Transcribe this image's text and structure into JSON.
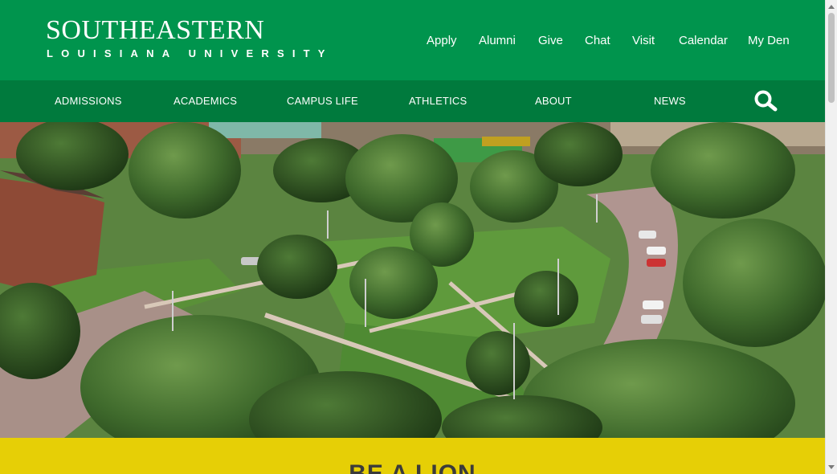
{
  "header": {
    "logo_main": "SOUTHEASTERN",
    "logo_sub": "LOUISIANA UNIVERSITY",
    "utility_links": [
      {
        "label": "Apply"
      },
      {
        "label": "Alumni"
      },
      {
        "label": "Give"
      },
      {
        "label": "Chat"
      },
      {
        "label": "Visit"
      },
      {
        "label": "Calendar"
      },
      {
        "label": "My Den"
      }
    ]
  },
  "main_nav": {
    "items": [
      {
        "label": "ADMISSIONS"
      },
      {
        "label": "ACADEMICS"
      },
      {
        "label": "CAMPUS LIFE"
      },
      {
        "label": "ATHLETICS"
      },
      {
        "label": "ABOUT"
      },
      {
        "label": "NEWS"
      }
    ],
    "search_icon": "search-icon"
  },
  "hero": {
    "image": "aerial campus photo"
  },
  "banner": {
    "heading": "BE A LION"
  },
  "colors": {
    "brand_green": "#00944d",
    "nav_green": "#007a3d",
    "banner_yellow": "#e6cf06",
    "heading_text": "#3b3b3b"
  }
}
